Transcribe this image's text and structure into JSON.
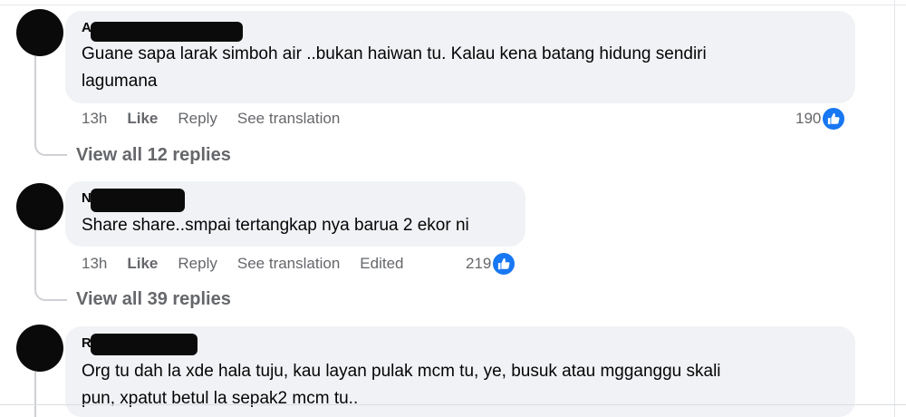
{
  "comments": [
    {
      "text": "Guane sapa larak simboh air ..bukan haiwan tu. Kalau kena batang hidung sendiri\nlagumana",
      "author_visible": "A",
      "time": "13h",
      "like": "Like",
      "reply": "Reply",
      "translate": "See translation",
      "reactions": "190",
      "view_replies": "View all 12 replies"
    },
    {
      "text": "Share share..smpai tertangkap nya barua 2 ekor ni",
      "author_visible": "N",
      "time": "13h",
      "like": "Like",
      "reply": "Reply",
      "translate": "See translation",
      "edited": "Edited",
      "reactions": "219",
      "view_replies": "View all 39 replies"
    },
    {
      "text": "Org tu dah la xde hala tuju, kau layan pulak mcm tu, ye, busuk atau mgganggu skali\npun, xpatut betul la sepak2 mcm tu..",
      "author_visible": "R"
    }
  ],
  "colors": {
    "like_blue": "#1877f2",
    "bubble": "#f0f2f5",
    "meta": "#65676b"
  },
  "icons": {
    "reaction": "thumbs-up-icon"
  }
}
